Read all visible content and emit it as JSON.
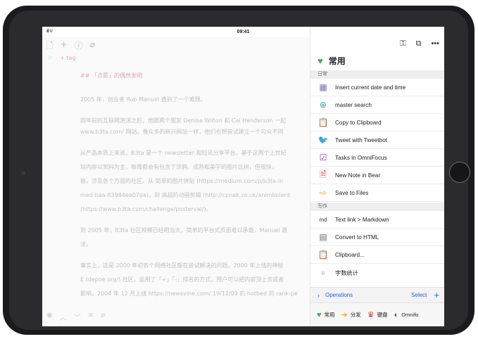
{
  "status": {
    "signal": "ııl ᯤ",
    "time": "09:41"
  },
  "editor": {
    "tag_label": "+ tag",
    "heading": "## 「点赞」的偶然发明",
    "paragraphs": [
      "2005 年，创业者 Rob Manuel 遇到了一个难题。",
      "四年前的互联网泡沫之后，他跟两个朋友 Denise Wilton 和 Cal Henderson 一起",
      "www.b3ta.com/ 网站。像众多的新兴网站一样，他们也想尝试建立一个与众不同",
      "从产品本质上来说，B3ta 是一个 newsletter 和短讯分享平台。基于这两个上世纪",
      "站内容以笑料为主，每周都会有包含了涂鸦、成熟和美学的图片比拼，但很快，",
      "容，涉及各个方面的社区。从 简单的图片拼贴 (https://medium.com/p/b3ta-in",
      "med-baa-83984ee07da)，到 高超的动画剪辑 (http://cpnak.co.uk/animbolerd",
      "(https://www.b3ta.com/challenge/posterval/)。",
      "到 2005 年，B3ta 社区规模已经相当大，简单的平台式页面难以承载，Manuel 跟",
      "法。",
      "事实上，这是 2000 年初各个网络社区都在尝试解决的问题。2000 年上线的神秘",
      "E.tdepoe.org/) 社区，运用了「+」「-」排名的方式，用户可以把内容顶上去或者",
      "影响，2004 年 12 月上线 https://newsvine.com/ 19/12/09 的 hotbed 的 rank-pe"
    ]
  },
  "panel": {
    "group_title": "常用",
    "sections": {
      "daily": "日常",
      "writing": "写作"
    },
    "daily_items": [
      {
        "label": "Insert current date and time",
        "icon": "calendar-icon"
      },
      {
        "label": "master search",
        "icon": "search-plus-icon"
      },
      {
        "label": "Copy to Clipboard",
        "icon": "clipboard-icon"
      },
      {
        "label": "Tweet with Tweetbot",
        "icon": "bird-icon"
      },
      {
        "label": "Tasks in OmniFocus",
        "icon": "check-icon"
      },
      {
        "label": "New Note in Bear",
        "icon": "note-icon"
      },
      {
        "label": "Save to Files",
        "icon": "folder-arrow-icon"
      }
    ],
    "writing_items": [
      {
        "label": "Text link > Markdown",
        "icon": "markdown-icon"
      },
      {
        "label": "Convert to HTML",
        "icon": "document-icon"
      },
      {
        "label": "Clipboard...",
        "icon": "clipboard-red-icon"
      },
      {
        "label": "字数统计",
        "icon": "circle-icon"
      }
    ],
    "ops": {
      "label": "Operations",
      "select": "Select"
    },
    "tabs": [
      "常用",
      "分发",
      "键盘",
      "Omnifo"
    ]
  },
  "colors": {
    "accent": "#2a5bd7",
    "green": "#34b24a"
  }
}
